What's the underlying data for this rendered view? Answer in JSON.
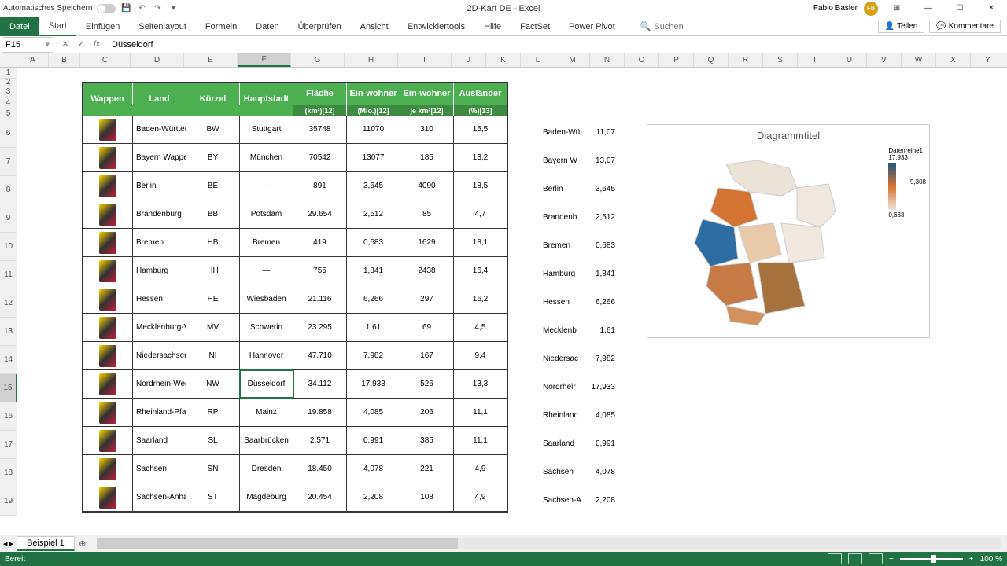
{
  "app": {
    "title": "2D-Kart DE - Excel",
    "user": "Fabio Basler",
    "initials": "FB"
  },
  "titlebar": {
    "autosave": "Automatisches Speichern"
  },
  "ribbon": {
    "file": "Datei",
    "tabs": [
      "Start",
      "Einfügen",
      "Seitenlayout",
      "Formeln",
      "Daten",
      "Überprüfen",
      "Ansicht",
      "Entwicklertools",
      "Hilfe",
      "FactSet",
      "Power Pivot"
    ],
    "search": "Suchen",
    "share": "Teilen",
    "comments": "Kommentare"
  },
  "formula_bar": {
    "cell_ref": "F15",
    "value": "Düsseldorf"
  },
  "columns": [
    "A",
    "B",
    "C",
    "D",
    "E",
    "F",
    "G",
    "H",
    "I",
    "J",
    "K",
    "L",
    "M",
    "N",
    "O",
    "P",
    "Q",
    "R",
    "S",
    "T",
    "U",
    "V",
    "W",
    "X",
    "Y"
  ],
  "row_numbers": [
    1,
    2,
    3,
    4,
    5,
    6,
    7,
    8,
    9,
    10,
    11,
    12,
    13,
    14,
    15,
    16,
    17,
    18
  ],
  "headers": {
    "wappen": "Wappen",
    "land": "Land",
    "kuerzel": "Kürzel",
    "hauptstadt": "Hauptstadt",
    "flaeche": "Fläche",
    "flaeche_sub": "(km²)[12]",
    "einwohner": "Ein-wohner",
    "einwohner_sub": "(Mio.)[12]",
    "einwohner2": "Ein-wohner",
    "einwohner2_sub": "je km²[12]",
    "auslaender": "Ausländer",
    "auslaender_sub": "(%)[13]"
  },
  "rows": [
    {
      "land": "Baden-Württem",
      "kz": "BW",
      "hs": "Stuttgart",
      "fl": "35748",
      "ew": "11070",
      "ewk": "310",
      "al": "15,5"
    },
    {
      "land": "Bayern Wappen",
      "kz": "BY",
      "hs": "München",
      "fl": "70542",
      "ew": "13077",
      "ewk": "185",
      "al": "13,2"
    },
    {
      "land": "Berlin",
      "kz": "BE",
      "hs": "—",
      "fl": "891",
      "ew": "3,645",
      "ewk": "4090",
      "al": "18,5"
    },
    {
      "land": "Brandenburg",
      "kz": "BB",
      "hs": "Potsdam",
      "fl": "29.654",
      "ew": "2,512",
      "ewk": "85",
      "al": "4,7"
    },
    {
      "land": "Bremen",
      "kz": "HB",
      "hs": "Bremen",
      "fl": "419",
      "ew": "0,683",
      "ewk": "1629",
      "al": "18,1"
    },
    {
      "land": "Hamburg",
      "kz": "HH",
      "hs": "—",
      "fl": "755",
      "ew": "1,841",
      "ewk": "2438",
      "al": "16,4"
    },
    {
      "land": "Hessen",
      "kz": "HE",
      "hs": "Wiesbaden",
      "fl": "21.116",
      "ew": "6,266",
      "ewk": "297",
      "al": "16,2"
    },
    {
      "land": "Mecklenburg-Vo",
      "kz": "MV",
      "hs": "Schwerin",
      "fl": "23.295",
      "ew": "1,61",
      "ewk": "69",
      "al": "4,5"
    },
    {
      "land": "Niedersachsen",
      "kz": "NI",
      "hs": "Hannover",
      "fl": "47.710",
      "ew": "7,982",
      "ewk": "167",
      "al": "9,4"
    },
    {
      "land": "Nordrhein-West",
      "kz": "NW",
      "hs": "Düsseldorf",
      "fl": "34.112",
      "ew": "17,933",
      "ewk": "526",
      "al": "13,3"
    },
    {
      "land": "Rheinland-Pfalz",
      "kz": "RP",
      "hs": "Mainz",
      "fl": "19.858",
      "ew": "4,085",
      "ewk": "206",
      "al": "11,1"
    },
    {
      "land": "Saarland",
      "kz": "SL",
      "hs": "Saarbrücken",
      "fl": "2.571",
      "ew": "0,991",
      "ewk": "385",
      "al": "11,1"
    },
    {
      "land": "Sachsen",
      "kz": "SN",
      "hs": "Dresden",
      "fl": "18.450",
      "ew": "4,078",
      "ewk": "221",
      "al": "4,9"
    },
    {
      "land": "Sachsen-Anhalt",
      "kz": "ST",
      "hs": "Magdeburg",
      "fl": "20.454",
      "ew": "2,208",
      "ewk": "108",
      "al": "4,9"
    }
  ],
  "side": [
    {
      "l": "Baden-Wü",
      "v": "11,07"
    },
    {
      "l": "Bayern W",
      "v": "13,07"
    },
    {
      "l": "Berlin",
      "v": "3,645"
    },
    {
      "l": "Brandenb",
      "v": "2,512"
    },
    {
      "l": "Bremen",
      "v": "0,683"
    },
    {
      "l": "Hamburg",
      "v": "1,841"
    },
    {
      "l": "Hessen",
      "v": "6,266"
    },
    {
      "l": "Mecklenb",
      "v": "1,61"
    },
    {
      "l": "Niedersac",
      "v": "7,982"
    },
    {
      "l": "Nordrheir",
      "v": "17,933"
    },
    {
      "l": "Rheinlanc",
      "v": "4,085"
    },
    {
      "l": "Saarland",
      "v": "0,991"
    },
    {
      "l": "Sachsen",
      "v": "4,078"
    },
    {
      "l": "Sachsen-A",
      "v": "2,208"
    }
  ],
  "chart": {
    "title": "Diagrammtitel",
    "series": "Datenreihe1",
    "max": "17,933",
    "mid": "9,308",
    "min": "0,683"
  },
  "chart_data": {
    "type": "map",
    "title": "Diagrammtitel",
    "series_name": "Datenreihe1",
    "regions": [
      {
        "name": "Baden-Württemberg",
        "value": 11.07
      },
      {
        "name": "Bayern",
        "value": 13.07
      },
      {
        "name": "Berlin",
        "value": 3.645
      },
      {
        "name": "Brandenburg",
        "value": 2.512
      },
      {
        "name": "Bremen",
        "value": 0.683
      },
      {
        "name": "Hamburg",
        "value": 1.841
      },
      {
        "name": "Hessen",
        "value": 6.266
      },
      {
        "name": "Mecklenburg-Vorpommern",
        "value": 1.61
      },
      {
        "name": "Niedersachsen",
        "value": 7.982
      },
      {
        "name": "Nordrhein-Westfalen",
        "value": 17.933
      },
      {
        "name": "Rheinland-Pfalz",
        "value": 4.085
      },
      {
        "name": "Saarland",
        "value": 0.991
      },
      {
        "name": "Sachsen",
        "value": 4.078
      },
      {
        "name": "Sachsen-Anhalt",
        "value": 2.208
      }
    ],
    "color_scale": {
      "min": 0.683,
      "mid": 9.308,
      "max": 17.933
    }
  },
  "sheet_tab": "Beispiel 1",
  "status": {
    "ready": "Bereit",
    "zoom": "100 %"
  }
}
